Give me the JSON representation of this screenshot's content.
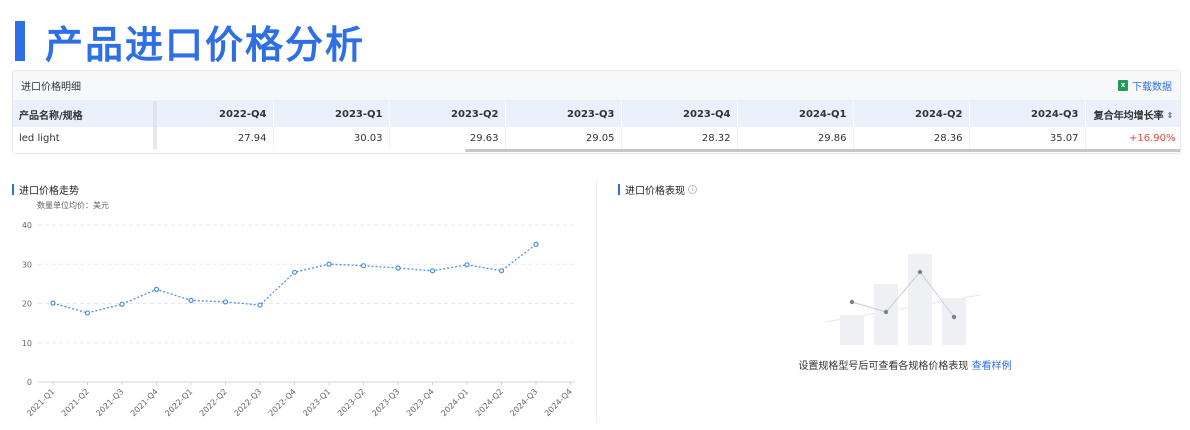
{
  "header": {
    "title": "产品进口价格分析",
    "accent": "#2f6fe6"
  },
  "table_card": {
    "title": "进口价格明细",
    "download_label": "下载数据",
    "download_icon": "excel-icon",
    "columns": [
      "产品名称/规格",
      "2022-Q4",
      "2023-Q1",
      "2023-Q2",
      "2023-Q3",
      "2023-Q4",
      "2024-Q1",
      "2024-Q2",
      "2024-Q3",
      "复合年均增长率"
    ],
    "rows": [
      {
        "name": "led light",
        "values": [
          "27.94",
          "30.03",
          "29.63",
          "29.05",
          "28.32",
          "29.86",
          "28.36",
          "35.07"
        ],
        "cagr": "+16.90%"
      }
    ],
    "cagr_color": "#e5473d"
  },
  "trend_section": {
    "title": "进口价格走势",
    "unit_label": "数量单位均价：美元"
  },
  "performance_section": {
    "title": "进口价格表现",
    "empty_text": "设置规格型号后可查看各规格价格表现",
    "sample_link": "查看样例"
  },
  "chart_data": {
    "type": "line",
    "categories": [
      "2021-Q1",
      "2021-Q2",
      "2021-Q3",
      "2021-Q4",
      "2022-Q1",
      "2022-Q2",
      "2022-Q3",
      "2022-Q4",
      "2023-Q1",
      "2023-Q2",
      "2023-Q3",
      "2023-Q4",
      "2024-Q1",
      "2024-Q2",
      "2024-Q3",
      "2024-Q4"
    ],
    "series": [
      {
        "values": [
          20.1,
          17.6,
          19.8,
          23.6,
          20.8,
          20.4,
          19.6,
          27.94,
          30.03,
          29.63,
          29.05,
          28.32,
          29.86,
          28.36,
          35.07,
          null
        ]
      }
    ],
    "yticks": [
      0,
      10,
      20,
      30,
      40
    ],
    "ylim": [
      0,
      40
    ],
    "grid": true,
    "line_style": "dotted",
    "color": "#4a8fe7"
  }
}
